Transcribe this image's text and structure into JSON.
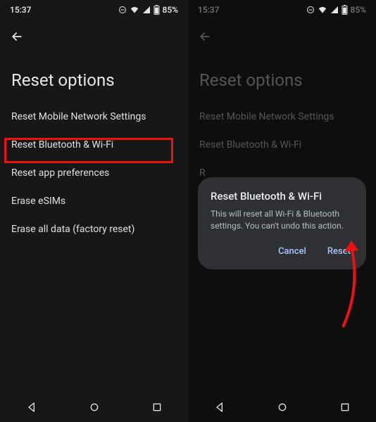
{
  "statusbar": {
    "time": "15:37",
    "battery": "85%"
  },
  "appbar": {
    "back_icon": "←"
  },
  "page": {
    "title": "Reset options"
  },
  "options": [
    "Reset Mobile Network Settings",
    "Reset Bluetooth & Wi-Fi",
    "Reset app preferences",
    "Erase eSIMs",
    "Erase all data (factory reset)"
  ],
  "dialog": {
    "title": "Reset Bluetooth & Wi-Fi",
    "body": "This will reset all Wi-Fi & Bluetooth settings. You can't undo this action.",
    "cancel": "Cancel",
    "confirm": "Reset"
  }
}
